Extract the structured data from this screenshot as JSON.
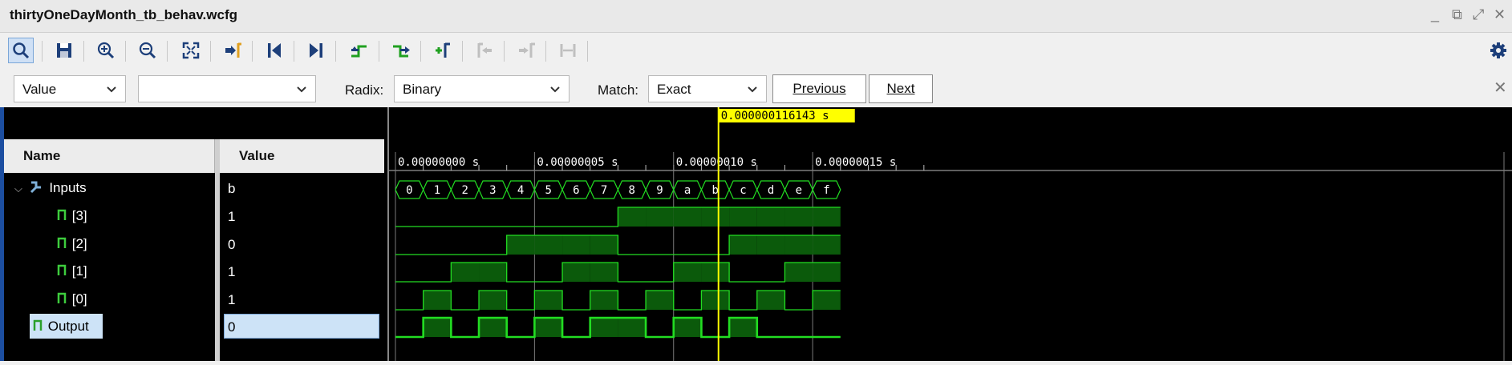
{
  "window": {
    "title": "thirtyOneDayMonth_tb_behav.wcfg"
  },
  "toolbar": {
    "buttons": [
      {
        "name": "search-icon"
      },
      {
        "name": "save-icon"
      },
      {
        "name": "zoom-in-icon"
      },
      {
        "name": "zoom-out-icon"
      },
      {
        "name": "zoom-fit-icon"
      },
      {
        "name": "go-to-cursor-icon"
      },
      {
        "name": "go-to-time-zero-icon"
      },
      {
        "name": "go-to-last-time-icon"
      },
      {
        "name": "previous-transition-icon"
      },
      {
        "name": "next-transition-icon"
      },
      {
        "name": "add-marker-icon"
      },
      {
        "name": "previous-marker-icon"
      },
      {
        "name": "next-marker-icon"
      },
      {
        "name": "swap-cursors-icon"
      }
    ],
    "settings_icon": "gear-icon"
  },
  "search": {
    "type_value": "Value",
    "search_value": "",
    "radix_label": "Radix:",
    "radix_value": "Binary",
    "match_label": "Match:",
    "match_value": "Exact",
    "previous_label": "Previous",
    "next_label": "Next"
  },
  "columns": {
    "name": "Name",
    "value": "Value"
  },
  "signals": [
    {
      "name": "Inputs",
      "value": "b",
      "group": true
    },
    {
      "name": "[3]",
      "value": "1"
    },
    {
      "name": "[2]",
      "value": "0"
    },
    {
      "name": "[1]",
      "value": "1"
    },
    {
      "name": "[0]",
      "value": "1"
    },
    {
      "name": "Output",
      "value": "0",
      "selected": true
    }
  ],
  "waveform": {
    "cursor_label": "0.000000116143 s",
    "cursor_time": 116.143,
    "time_range_ns": [
      0,
      200
    ],
    "time_labels": [
      "0.00000000 s",
      "0.00000005 s",
      "0.00000010 s",
      "0.00000015 s"
    ],
    "bus_values": [
      "0",
      "1",
      "2",
      "3",
      "4",
      "5",
      "6",
      "7",
      "8",
      "9",
      "a",
      "b",
      "c",
      "d",
      "e",
      "f"
    ],
    "bits": {
      "b3": [
        0,
        0,
        0,
        0,
        0,
        0,
        0,
        0,
        1,
        1,
        1,
        1,
        1,
        1,
        1,
        1
      ],
      "b2": [
        0,
        0,
        0,
        0,
        1,
        1,
        1,
        1,
        0,
        0,
        0,
        0,
        1,
        1,
        1,
        1
      ],
      "b1": [
        0,
        0,
        1,
        1,
        0,
        0,
        1,
        1,
        0,
        0,
        1,
        1,
        0,
        0,
        1,
        1
      ],
      "b0": [
        0,
        1,
        0,
        1,
        0,
        1,
        0,
        1,
        0,
        1,
        0,
        1,
        0,
        1,
        0,
        1
      ],
      "out": [
        0,
        1,
        0,
        1,
        0,
        1,
        0,
        1,
        1,
        0,
        1,
        0,
        1,
        0,
        0,
        0
      ]
    },
    "colors": {
      "wave": "#22dd22",
      "fill": "#0b5a0b",
      "cursor": "#ffff00",
      "grid": "#7a7a7a"
    }
  }
}
